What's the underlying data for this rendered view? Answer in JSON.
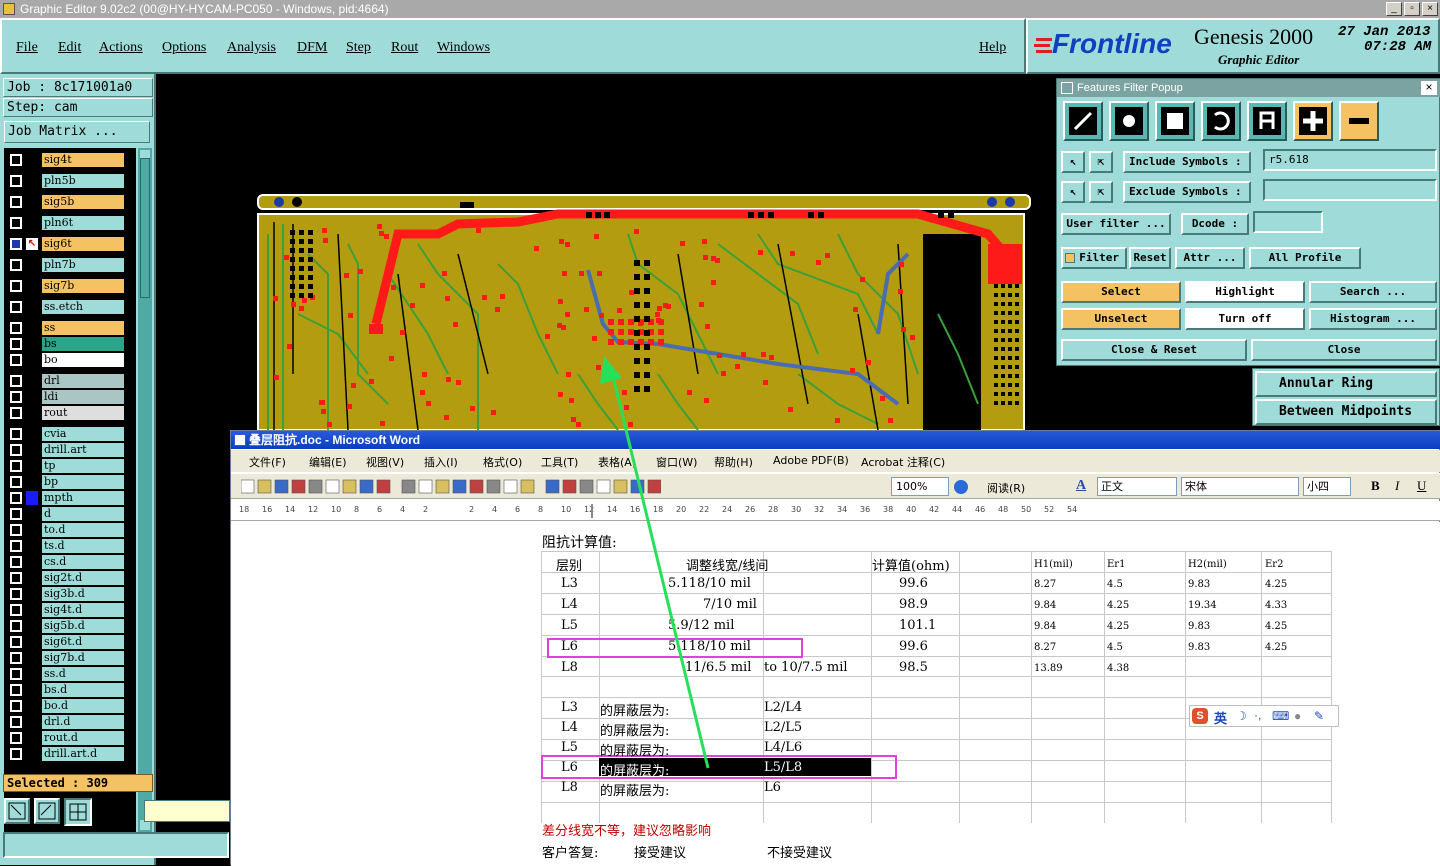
{
  "window": {
    "title": "Graphic Editor 9.02c2 (00@HY-HYCAM-PC050 - Windows, pid:4664)"
  },
  "menu": {
    "items": [
      "File",
      "Edit",
      "Actions",
      "Options",
      "Analysis",
      "DFM",
      "Step",
      "Rout",
      "Windows"
    ],
    "help": "Help"
  },
  "brand": {
    "logo": "Frontline",
    "product": "Genesis 2000",
    "subtitle": "Graphic Editor",
    "date": "27 Jan 2013",
    "time": "07:28 AM"
  },
  "left": {
    "job": "Job : 8c171001a0",
    "step": "Step: cam",
    "job_matrix": "Job Matrix ...",
    "layers": [
      {
        "name": "sig4t",
        "color": "#f5c263"
      },
      {
        "name": "pln5b",
        "color": "#9fdcd9"
      },
      {
        "name": "sig5b",
        "color": "#f5c263"
      },
      {
        "name": "pln6t",
        "color": "#9fdcd9"
      },
      {
        "name": "sig6t",
        "color": "#f5c263"
      },
      {
        "name": "pln7b",
        "color": "#9fdcd9"
      },
      {
        "name": "sig7b",
        "color": "#f5c263"
      },
      {
        "name": "ss.etch",
        "color": "#9fdcd9"
      },
      {
        "name": "ss",
        "color": "#f5c263"
      },
      {
        "name": "bs",
        "color": "#2aa58a"
      },
      {
        "name": "bo",
        "color": "#ffffff"
      },
      {
        "name": "drl",
        "color": "#a9c6c4"
      },
      {
        "name": "ldi",
        "color": "#a9c6c4"
      },
      {
        "name": "rout",
        "color": "#dedede"
      },
      {
        "name": "cvia",
        "color": "#9fdcd9"
      },
      {
        "name": "drill.art",
        "color": "#9fdcd9"
      },
      {
        "name": "tp",
        "color": "#9fdcd9"
      },
      {
        "name": "bp",
        "color": "#9fdcd9"
      },
      {
        "name": "mpth",
        "color": "#9fdcd9"
      },
      {
        "name": "d",
        "color": "#9fdcd9"
      },
      {
        "name": "to.d",
        "color": "#9fdcd9"
      },
      {
        "name": "ts.d",
        "color": "#9fdcd9"
      },
      {
        "name": "cs.d",
        "color": "#9fdcd9"
      },
      {
        "name": "sig2t.d",
        "color": "#9fdcd9"
      },
      {
        "name": "sig3b.d",
        "color": "#9fdcd9"
      },
      {
        "name": "sig4t.d",
        "color": "#9fdcd9"
      },
      {
        "name": "sig5b.d",
        "color": "#9fdcd9"
      },
      {
        "name": "sig6t.d",
        "color": "#9fdcd9"
      },
      {
        "name": "sig7b.d",
        "color": "#9fdcd9"
      },
      {
        "name": "ss.d",
        "color": "#9fdcd9"
      },
      {
        "name": "bs.d",
        "color": "#9fdcd9"
      },
      {
        "name": "bo.d",
        "color": "#9fdcd9"
      },
      {
        "name": "drl.d",
        "color": "#9fdcd9"
      },
      {
        "name": "rout.d",
        "color": "#9fdcd9"
      },
      {
        "name": "drill.art.d",
        "color": "#9fdcd9"
      }
    ],
    "selected": "Selected : 309",
    "xy_label": "X Y :"
  },
  "filter": {
    "title": "Features Filter Popup",
    "include_label": "Include Symbols :",
    "include_value": "r5.618",
    "exclude_label": "Exclude Symbols :",
    "user_filter": "User filter ...",
    "dcode": "Dcode :",
    "filter": "Filter",
    "reset": "Reset",
    "attr": "Attr ...",
    "all_profile": "All Profile",
    "select": "Select",
    "highlight": "Highlight",
    "search": "Search ...",
    "unselect": "Unselect",
    "turn_off": "Turn off",
    "histogram": "Histogram ...",
    "close_reset": "Close & Reset",
    "close": "Close",
    "annular": "Annular Ring",
    "between": "Between Midpoints"
  },
  "word": {
    "title": "叠层阻抗.doc - Microsoft Word",
    "menus": [
      "文件(F)",
      "编辑(E)",
      "视图(V)",
      "插入(I)",
      "格式(O)",
      "工具(T)",
      "表格(A)",
      "窗口(W)",
      "帮助(H)",
      "Adobe PDF(B)",
      "Acrobat 注释(C)"
    ],
    "zoom": "100%",
    "read": "阅读(R)",
    "style": "正文",
    "font": "宋体",
    "size": "小四",
    "heading": "阻抗计算值:",
    "col_layer": "层别",
    "col_adjust": "调整线宽/线间",
    "col_calc": "计算值(ohm)",
    "col_h1": "H1(mil)",
    "col_er1": "Er1",
    "col_h2": "H2(mil)",
    "col_er2": "Er2",
    "rows": [
      {
        "layer": "L3",
        "adjust": "5.118/10 mil",
        "calc": "99.6",
        "h1": "8.27",
        "er1": "4.5",
        "h2": "9.83",
        "er2": "4.25"
      },
      {
        "layer": "L4",
        "adjust": "7/10 mil",
        "calc": "98.9",
        "h1": "9.84",
        "er1": "4.25",
        "h2": "19.34",
        "er2": "4.33"
      },
      {
        "layer": "L5",
        "adjust": "5.9/12 mil",
        "calc": "101.1",
        "h1": "9.84",
        "er1": "4.25",
        "h2": "9.83",
        "er2": "4.25"
      },
      {
        "layer": "L6",
        "adjust": "5.118/10 mil",
        "calc": "99.6",
        "h1": "8.27",
        "er1": "4.5",
        "h2": "9.83",
        "er2": "4.25"
      },
      {
        "layer": "L8",
        "adjust": "11/6.5 mil",
        "adjust2": "to  10/7.5 mil",
        "calc": "98.5",
        "h1": "13.89",
        "er1": "4.38",
        "h2": "",
        "er2": ""
      }
    ],
    "shield_label": "的屏蔽层为:",
    "shields": [
      {
        "layer": "L3",
        "ref": "L2/L4"
      },
      {
        "layer": "L4",
        "ref": "L2/L5"
      },
      {
        "layer": "L5",
        "ref": "L4/L6"
      },
      {
        "layer": "L6",
        "ref": "L5/L8"
      },
      {
        "layer": "L8",
        "ref": "L6"
      }
    ],
    "note": "差分线宽不等，建议忽略影响",
    "reply_label": "客户答复:",
    "accept": "接受建议",
    "reject": "不接受建议",
    "ime": "英"
  },
  "colors": {
    "highlight_box": "#e040e0",
    "arrow": "#27e05a",
    "board": "#b39c10",
    "trace_red": "#ff1a1a",
    "trace_blue": "#4a6cb0",
    "trace_green": "#3aa03a"
  }
}
